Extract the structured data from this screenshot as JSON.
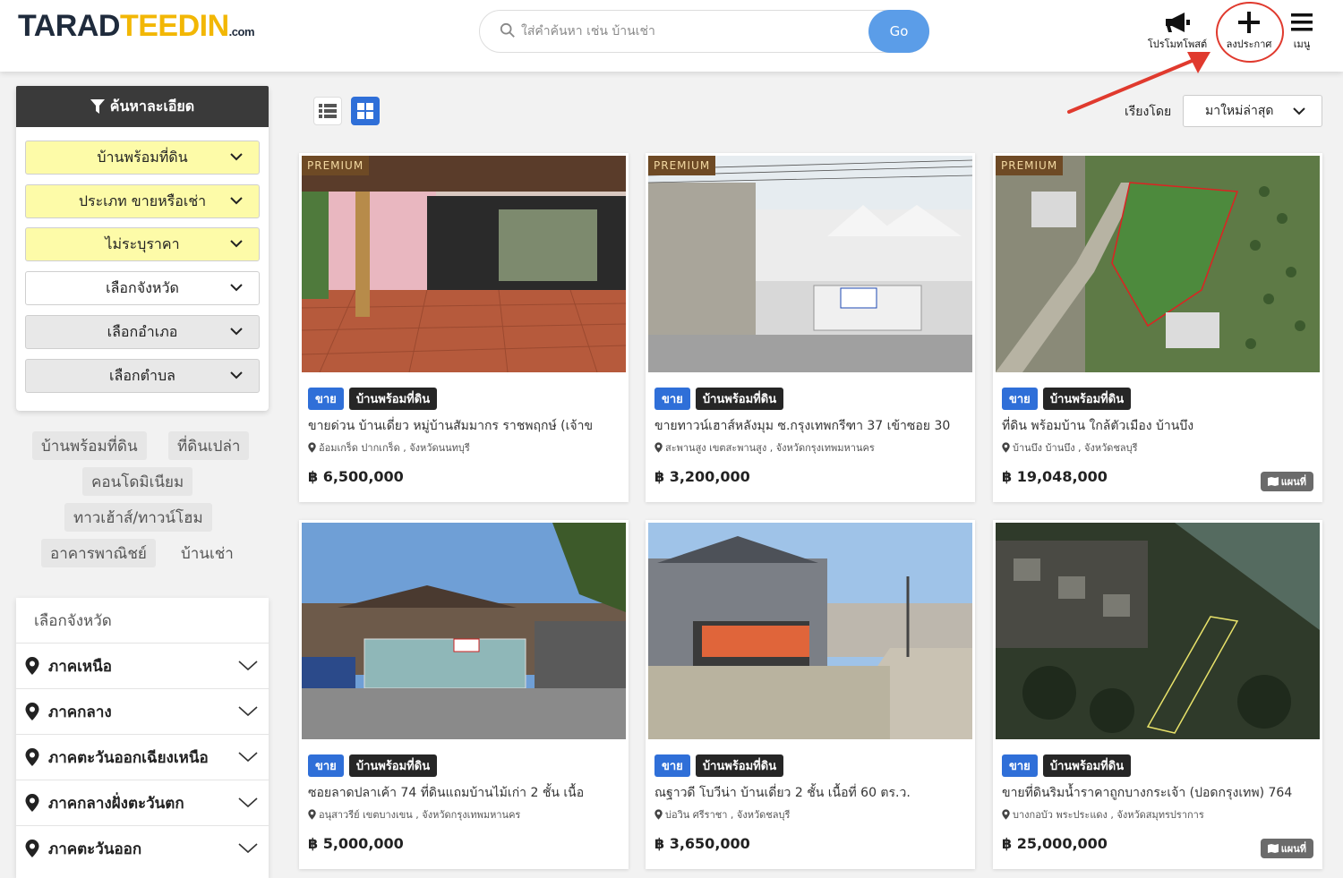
{
  "header": {
    "logo_main": "TARAD",
    "logo_accent": "TEEDIN",
    "logo_suffix": ".com",
    "search_placeholder": "ใส่คำค้นหา เช่น บ้านเช่า",
    "search_button": "Go",
    "promote_label": "โปรโมทโพสต์",
    "post_label": "ลงประกาศ",
    "menu_label": "เมนู"
  },
  "filter": {
    "title": "ค้นหาละเอียด",
    "selects": [
      "บ้านพร้อมที่ดิน",
      "ประเภท ขายหรือเช่า",
      "ไม่ระบุราคา",
      "เลือกจังหวัด",
      "เลือกอำเภอ",
      "เลือกตำบล"
    ]
  },
  "tags": [
    "บ้านพร้อมที่ดิน",
    "ที่ดินเปล่า",
    "คอนโดมิเนียม",
    "ทาวเฮ้าส์/ทาวน์โฮม",
    "อาคารพาณิชย์",
    "บ้านเช่า"
  ],
  "regions": {
    "title": "เลือกจังหวัด",
    "items": [
      "ภาคเหนือ",
      "ภาคกลาง",
      "ภาคตะวันออกเฉียงเหนือ",
      "ภาคกลางฝั่งตะวันตก",
      "ภาคตะวันออก"
    ]
  },
  "toolbar": {
    "sort_label": "เรียงโดย",
    "sort_value": "มาใหม่ล่าสุด"
  },
  "listings": [
    {
      "premium": "PREMIUM",
      "sale": "ขาย",
      "type": "บ้านพร้อมที่ดิน",
      "title": "ขายด่วน บ้านเดี่ยว หมู่บ้านสัมมากร ราชพฤกษ์ (เจ้าข",
      "location": "อ้อมเกร็ด ปากเกร็ด , จังหวัดนนทบุรี",
      "price": "฿ 6,500,000",
      "map": ""
    },
    {
      "premium": "PREMIUM",
      "sale": "ขาย",
      "type": "บ้านพร้อมที่ดิน",
      "title": "ขายทาวน์เฮาส์หลังมุม ซ.กรุงเทพกรีฑา 37 เข้าซอย 30",
      "location": "สะพานสูง เขตสะพานสูง , จังหวัดกรุงเทพมหานคร",
      "price": "฿ 3,200,000",
      "map": ""
    },
    {
      "premium": "PREMIUM",
      "sale": "ขาย",
      "type": "บ้านพร้อมที่ดิน",
      "title": "ที่ดิน พร้อมบ้าน ใกล้ตัวเมือง บ้านบึง",
      "location": "บ้านบึง บ้านบึง , จังหวัดชลบุรี",
      "price": "฿ 19,048,000",
      "map": "แผนที่"
    },
    {
      "premium": "",
      "sale": "ขาย",
      "type": "บ้านพร้อมที่ดิน",
      "title": "ซอยลาดปลาเค้า 74 ที่ดินแถมบ้านไม้เก่า 2 ชั้น เนื้อ",
      "location": "อนุสาวรีย์ เขตบางเขน , จังหวัดกรุงเทพมหานคร",
      "price": "฿ 5,000,000",
      "map": ""
    },
    {
      "premium": "",
      "sale": "ขาย",
      "type": "บ้านพร้อมที่ดิน",
      "title": "ณฐาวดี โบวีน่า บ้านเดี่ยว 2 ชั้น เนื้อที่ 60 ตร.ว.",
      "location": "บ่อวิน ศรีราชา , จังหวัดชลบุรี",
      "price": "฿ 3,650,000",
      "map": ""
    },
    {
      "premium": "",
      "sale": "ขาย",
      "type": "บ้านพร้อมที่ดิน",
      "title": "ขายที่ดินริมน้ำราคาถูกบางกระเจ้า (ปอดกรุงเทพ) 764",
      "location": "บางกอบัว พระประแดง , จังหวัดสมุทรปราการ",
      "price": "฿ 25,000,000",
      "map": "แผนที่"
    }
  ],
  "colors": {
    "accent": "#f2b705",
    "primary": "#2f6fd8",
    "premium": "#6e4a25",
    "highlight": "#e03a2e"
  }
}
